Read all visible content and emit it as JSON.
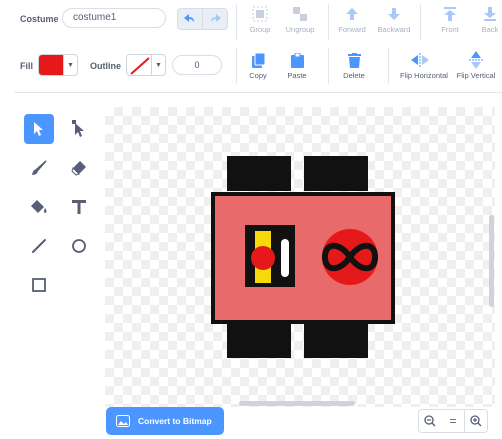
{
  "costume": {
    "label": "Costume",
    "name_value": "costume1"
  },
  "fill": {
    "label": "Fill",
    "color": "#e5191a"
  },
  "outline": {
    "label": "Outline",
    "width_value": "0"
  },
  "toolbar": {
    "group_label": "Group",
    "ungroup_label": "Ungroup",
    "forward_label": "Forward",
    "backward_label": "Backward",
    "front_label": "Front",
    "back_label": "Back",
    "copy_label": "Copy",
    "paste_label": "Paste",
    "delete_label": "Delete",
    "flip_h_label": "Flip Horizontal",
    "flip_v_label": "Flip Vertical"
  },
  "left_tools": [
    "select-tool",
    "reshape-tool",
    "brush-tool",
    "eraser-tool",
    "fill-tool",
    "text-tool",
    "line-tool",
    "circle-tool",
    "rectangle-tool"
  ],
  "convert_button": {
    "label": "Convert to Bitmap"
  },
  "zoom": {
    "zoom_out_icon": "zoom-out-icon",
    "reset_symbol": "=",
    "zoom_in_icon": "zoom-in-icon"
  },
  "colors": {
    "accent": "#4c97ff",
    "text": "#575e75",
    "robot_body": "#e86a6a",
    "robot_dark": "#111111",
    "infinity_circle": "#e5191a",
    "indicator_yellow": "#f5d90a"
  }
}
